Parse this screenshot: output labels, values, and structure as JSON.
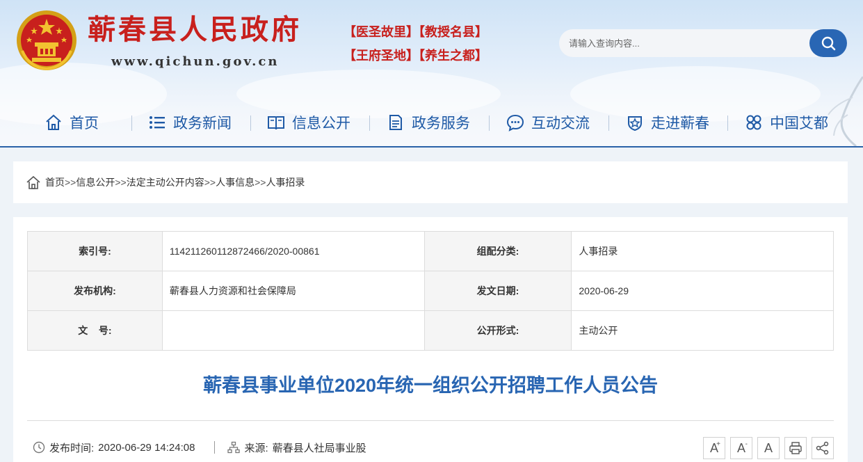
{
  "header": {
    "site_title": "蕲春县人民政府",
    "site_url": "www.qichun.gov.cn",
    "slogans": [
      "【医圣故里】【教授名县】",
      "【王府圣地】【养生之都】"
    ],
    "search_placeholder": "请输入查询内容..."
  },
  "nav": [
    {
      "label": "首页",
      "icon": "home-icon"
    },
    {
      "label": "政务新闻",
      "icon": "list-icon"
    },
    {
      "label": "信息公开",
      "icon": "book-icon"
    },
    {
      "label": "政务服务",
      "icon": "document-icon"
    },
    {
      "label": "互动交流",
      "icon": "chat-icon"
    },
    {
      "label": "走进蕲春",
      "icon": "badge-icon"
    },
    {
      "label": "中国艾都",
      "icon": "clover-icon"
    }
  ],
  "breadcrumb": {
    "items": [
      "首页",
      "信息公开",
      "法定主动公开内容",
      "人事信息",
      "人事招录"
    ],
    "separator": ">>"
  },
  "meta": {
    "index_label": "索引号:",
    "index_value": "114211260112872466/2020-00861",
    "category_label": "组配分类:",
    "category_value": "人事招录",
    "publisher_label": "发布机构:",
    "publisher_value": "蕲春县人力资源和社会保障局",
    "date_label": "发文日期:",
    "date_value": "2020-06-29",
    "docno_label": "文    号:",
    "docno_value": "",
    "form_label": "公开形式:",
    "form_value": "主动公开"
  },
  "article": {
    "title": "蕲春县事业单位2020年统一组织公开招聘工作人员公告",
    "publish_time_label": "发布时间:",
    "publish_time": "2020-06-29 14:24:08",
    "source_label": "来源:",
    "source": "蕲春县人社局事业股"
  },
  "tools": {
    "font_larger": "A",
    "font_smaller": "A",
    "font_default": "A"
  },
  "colors": {
    "title_red": "#c8201d",
    "nav_blue": "#1f5aa6",
    "article_title_blue": "#2865b2",
    "search_button": "#2966b4"
  }
}
